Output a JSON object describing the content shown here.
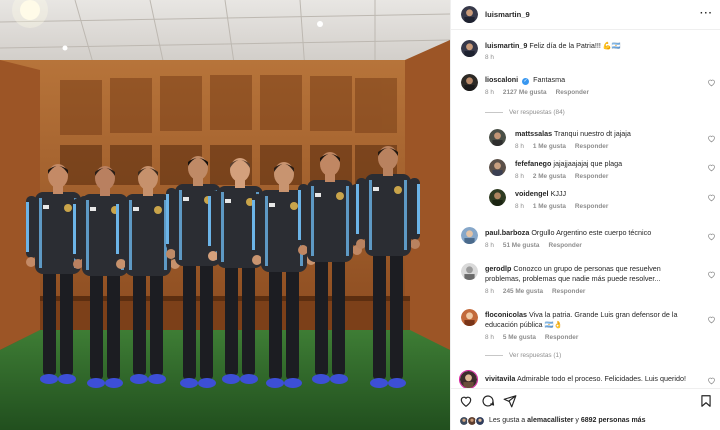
{
  "post": {
    "author": "luismartin_9",
    "caption": "Feliz día de la Patria!!! 💪🇦🇷",
    "caption_time": "8 h",
    "more_label": "···"
  },
  "comments": [
    {
      "user": "lioscaloni",
      "verified": true,
      "text": "Fantasma",
      "time": "8 h",
      "likes": "2127 Me gusta",
      "reply": "Responder",
      "replies_label": "Ver respuestas (84)"
    },
    {
      "user": "mattssalas",
      "text": "Tranqui nuestro dt jajaja",
      "time": "8 h",
      "likes": "1 Me gusta",
      "reply": "Responder"
    },
    {
      "user": "fefefanego",
      "text": "jajajjaajajaj que plaga",
      "time": "8 h",
      "likes": "2 Me gusta",
      "reply": "Responder"
    },
    {
      "user": "voidengel",
      "text": "KJJJ",
      "time": "8 h",
      "likes": "1 Me gusta",
      "reply": "Responder"
    },
    {
      "user": "paul.barboza",
      "text": "Orgullo Argentino este cuerpo técnico",
      "time": "8 h",
      "likes": "51 Me gusta",
      "reply": "Responder"
    },
    {
      "user": "gerodlp",
      "text": "Conozco un grupo de personas que resuelven",
      "text2": "problemas, problemas que nadie más puede resolver...",
      "time": "8 h",
      "likes": "245 Me gusta",
      "reply": "Responder"
    },
    {
      "user": "floconicolas",
      "text": "Viva la patria. Grande Luis gran defensor de la",
      "text2": "educación pública 🇦🇷👌",
      "time": "8 h",
      "likes": "5 Me gusta",
      "reply": "Responder",
      "replies_label": "Ver respuestas (1)"
    },
    {
      "user": "vivitavila",
      "text": "Admirable todo el proceso. Felicidades. Luis querido!"
    }
  ],
  "footer": {
    "likes_prefix": "Les gusta a",
    "likes_user": "alemacallister",
    "likes_mid": "y",
    "likes_count": "6892 personas más"
  },
  "icons": {
    "heart": "heart-icon",
    "comment": "comment-icon",
    "share": "share-icon",
    "save": "bookmark-icon"
  },
  "colors": {
    "muted": "#8e8e8e",
    "verified": "#3897f0",
    "jersey": "#2b2d33",
    "jersey_accent": "#6cb4e8",
    "wood": "#a9662f",
    "turf": "#2e6a2b"
  }
}
